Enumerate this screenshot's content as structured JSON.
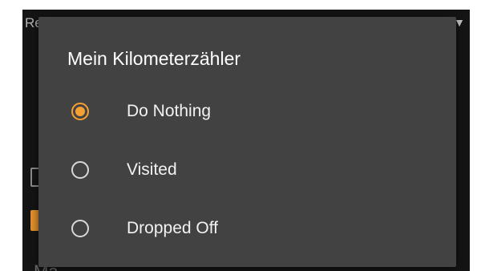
{
  "background": {
    "top_text": "Re",
    "bottom_text": "Ma",
    "dropdown_icon": "caret-down-icon"
  },
  "dialog": {
    "title": "Mein Kilometerzähler",
    "options": [
      {
        "label": "Do Nothing",
        "selected": true
      },
      {
        "label": "Visited",
        "selected": false
      },
      {
        "label": "Dropped Off",
        "selected": false
      }
    ]
  },
  "colors": {
    "accent": "#f5a033",
    "dialog_bg": "#424242",
    "app_bg": "#141414"
  }
}
